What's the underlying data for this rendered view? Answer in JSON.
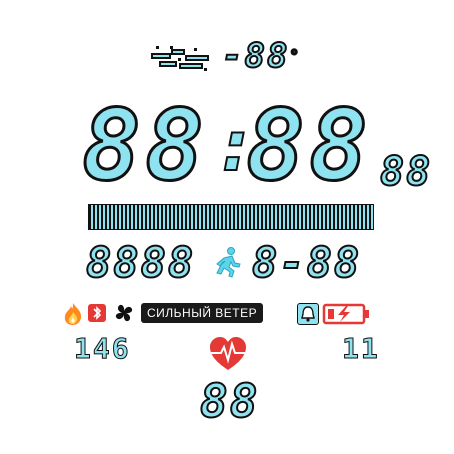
{
  "colors": {
    "segment": "#8fe3f0",
    "outline": "#111111",
    "red": "#e53935",
    "orange": "#ff8a1f",
    "blue_icon": "#5fd4e8"
  },
  "weather": {
    "icon": "snow-wind-icon",
    "temperature": "-88",
    "degree_symbol": "°"
  },
  "time": {
    "hours": "88",
    "separator": ":",
    "minutes": "88",
    "seconds": "88"
  },
  "date_bar": {
    "text": "▓▓▓▓▓▓▓▓▓▓▓▓▓▓▓▓▓▓▓▓▓▓▓▓▓"
  },
  "activity": {
    "steps": "8888",
    "step_icon": "running-person-icon",
    "date": "8-88"
  },
  "status": {
    "fire_icon": "fire-icon",
    "bluetooth_icon": "bluetooth-icon",
    "fan_icon": "fan-icon",
    "wind_text": "СИЛЬНЫЙ ВЕТЕР",
    "bell_icon": "bell-icon",
    "battery_icon": "battery-charging-icon"
  },
  "bottom": {
    "calories": "146",
    "heart_icon": "heart-pulse-icon",
    "distance": "11",
    "heart_rate": "88"
  }
}
